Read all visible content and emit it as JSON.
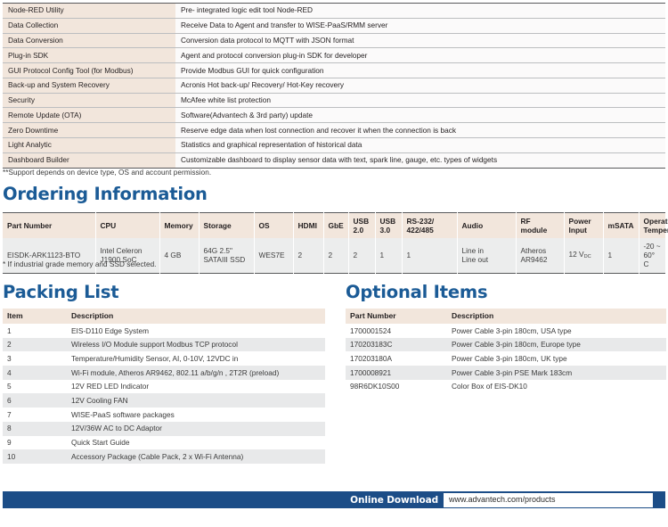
{
  "feature_table": {
    "rows": [
      {
        "name": "Node-RED Utility",
        "description": "Pre- integrated logic edit tool Node-RED"
      },
      {
        "name": "Data Collection",
        "description": "Receive Data to Agent and transfer to WISE-PaaS/RMM server"
      },
      {
        "name": "Data Conversion",
        "description": "Conversion data protocol to MQTT with JSON format"
      },
      {
        "name": "Plug-in SDK",
        "description": "Agent and protocol conversion plug-in SDK for developer"
      },
      {
        "name": "GUI Protocol Config Tool (for Modbus)",
        "description": "Provide Modbus GUI for quick configuration"
      },
      {
        "name": "Back-up and System Recovery",
        "description": "Acronis Hot back-up/ Recovery/ Hot-Key recovery"
      },
      {
        "name": "Security",
        "description": "McAfee white list protection"
      },
      {
        "name": "Remote Update (OTA)",
        "description": "Software(Advantech & 3rd party) update"
      },
      {
        "name": "Zero Downtime",
        "description": "Reserve edge data when lost connection and recover it when the connection is back"
      },
      {
        "name": "Light Analytic",
        "description": "Statistics and graphical representation of historical data"
      },
      {
        "name": "Dashboard Builder",
        "description": "Customizable dashboard to display sensor data with text, spark line, gauge, etc. types of widgets"
      }
    ],
    "footnote": "**Support depends on device type, OS and account permission."
  },
  "ordering": {
    "heading": "Ordering Information",
    "headers": [
      "Part Number",
      "CPU",
      "Memory",
      "Storage",
      "OS",
      "HDMI",
      "GbE",
      "USB 2.0",
      "USB 3.0",
      "RS-232/ 422/485",
      "Audio",
      "RF module",
      "Power Input",
      "mSATA",
      "Operating Temperature*"
    ],
    "header_lines": {
      "usb20_l1": "USB",
      "usb20_l2": "2.0",
      "usb30_l1": "USB",
      "usb30_l2": "3.0",
      "serial_l1": "RS-232/",
      "serial_l2": "422/485",
      "rf_l1": "RF",
      "rf_l2": "module",
      "power_l1": "Power",
      "power_l2": "Input",
      "temp_l1": "Operating",
      "temp_l2": "Temperature*"
    },
    "row": {
      "part_number": "EISDK-ARK1123-BTO",
      "cpu_l1": "Intel Celeron",
      "cpu_l2": "J1900 SoC",
      "memory": "4 GB",
      "storage_l1": "64G 2.5\"",
      "storage_l2": "SATAIII SSD",
      "os": "WES7E",
      "hdmi": "2",
      "gbe": "2",
      "usb20": "2",
      "usb30": "1",
      "serial": "1",
      "audio_l1": "Line in",
      "audio_l2": "Line out",
      "rf_l1": "Atheros",
      "rf_l2": "AR9462",
      "power_value": "12 V",
      "power_sub": "DC",
      "msata": "1",
      "temperature": "-20 ~ 60° C"
    },
    "footnote": "* If industrial grade memory and SSD selected."
  },
  "packing_list": {
    "heading": "Packing List",
    "columns": {
      "item": "Item",
      "description": "Description"
    },
    "rows": [
      {
        "item": "1",
        "description": "EIS-D110 Edge System"
      },
      {
        "item": "2",
        "description": "Wireless I/O Module support Modbus TCP protocol"
      },
      {
        "item": "3",
        "description": "Temperature/Humidity Sensor, AI, 0-10V, 12VDC in"
      },
      {
        "item": "4",
        "description": "Wi-Fi module, Atheros AR9462, 802.11 a/b/g/n , 2T2R (preload)"
      },
      {
        "item": "5",
        "description": "12V RED LED Indicator"
      },
      {
        "item": "6",
        "description": "12V Cooling FAN"
      },
      {
        "item": "7",
        "description": "WISE-PaaS software packages"
      },
      {
        "item": "8",
        "description": "12V/36W AC to DC Adaptor"
      },
      {
        "item": "9",
        "description": "Quick Start Guide"
      },
      {
        "item": "10",
        "description": "Accessory Package (Cable Pack, 2 x Wi-Fi Antenna)"
      }
    ]
  },
  "optional_items": {
    "heading": "Optional Items",
    "columns": {
      "part_number": "Part Number",
      "description": "Description"
    },
    "rows": [
      {
        "part_number": "1700001524",
        "description": "Power Cable 3-pin 180cm, USA type"
      },
      {
        "part_number": "170203183C",
        "description": "Power Cable 3-pin 180cm, Europe type"
      },
      {
        "part_number": "170203180A",
        "description": "Power Cable 3-pin 180cm, UK type"
      },
      {
        "part_number": "1700008921",
        "description": "Power Cable 3-pin PSE Mark 183cm"
      },
      {
        "part_number": "98R6DK10S00",
        "description": "Color Box of EIS-DK10"
      }
    ]
  },
  "footer": {
    "online_download_label": "Online Download",
    "url": "www.advantech.com/products",
    "bar_color": "#1c4d87"
  },
  "colors": {
    "heading_blue": "#1b5b96",
    "header_beige": "#f2e6dc",
    "row_gray": "#e8e9ea",
    "rule_dark": "#58595b"
  }
}
